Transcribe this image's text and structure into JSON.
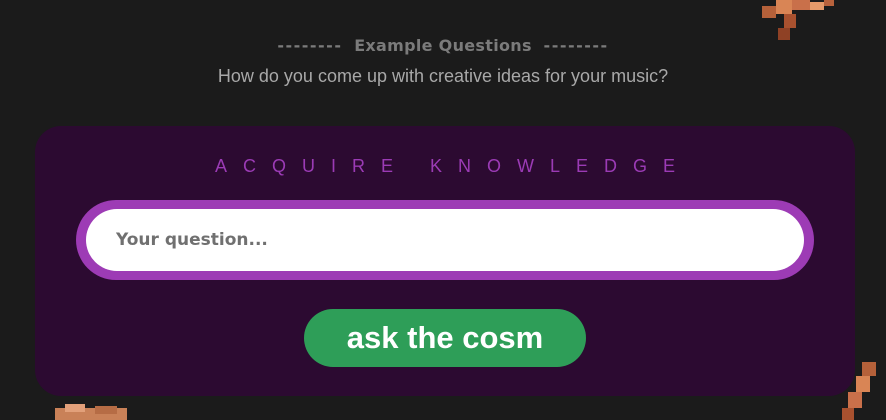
{
  "examples": {
    "heading_dashes_left": "--------",
    "heading": "Example Questions",
    "heading_dashes_right": "--------",
    "question": "How do you come up with creative ideas for your music?"
  },
  "panel": {
    "title": "ACQUIRE KNOWLEDGE",
    "input_placeholder": "Your question...",
    "input_value": "",
    "button_label": "ask the cosm"
  },
  "colors": {
    "background": "#1b1b1b",
    "panel": "#2c0a31",
    "accent_purple": "#9d3bb5",
    "button_green": "#2e9e58"
  },
  "decorations": [
    "voxel-figure-top-right",
    "voxel-figure-bottom-right",
    "voxel-figure-bottom-left"
  ]
}
